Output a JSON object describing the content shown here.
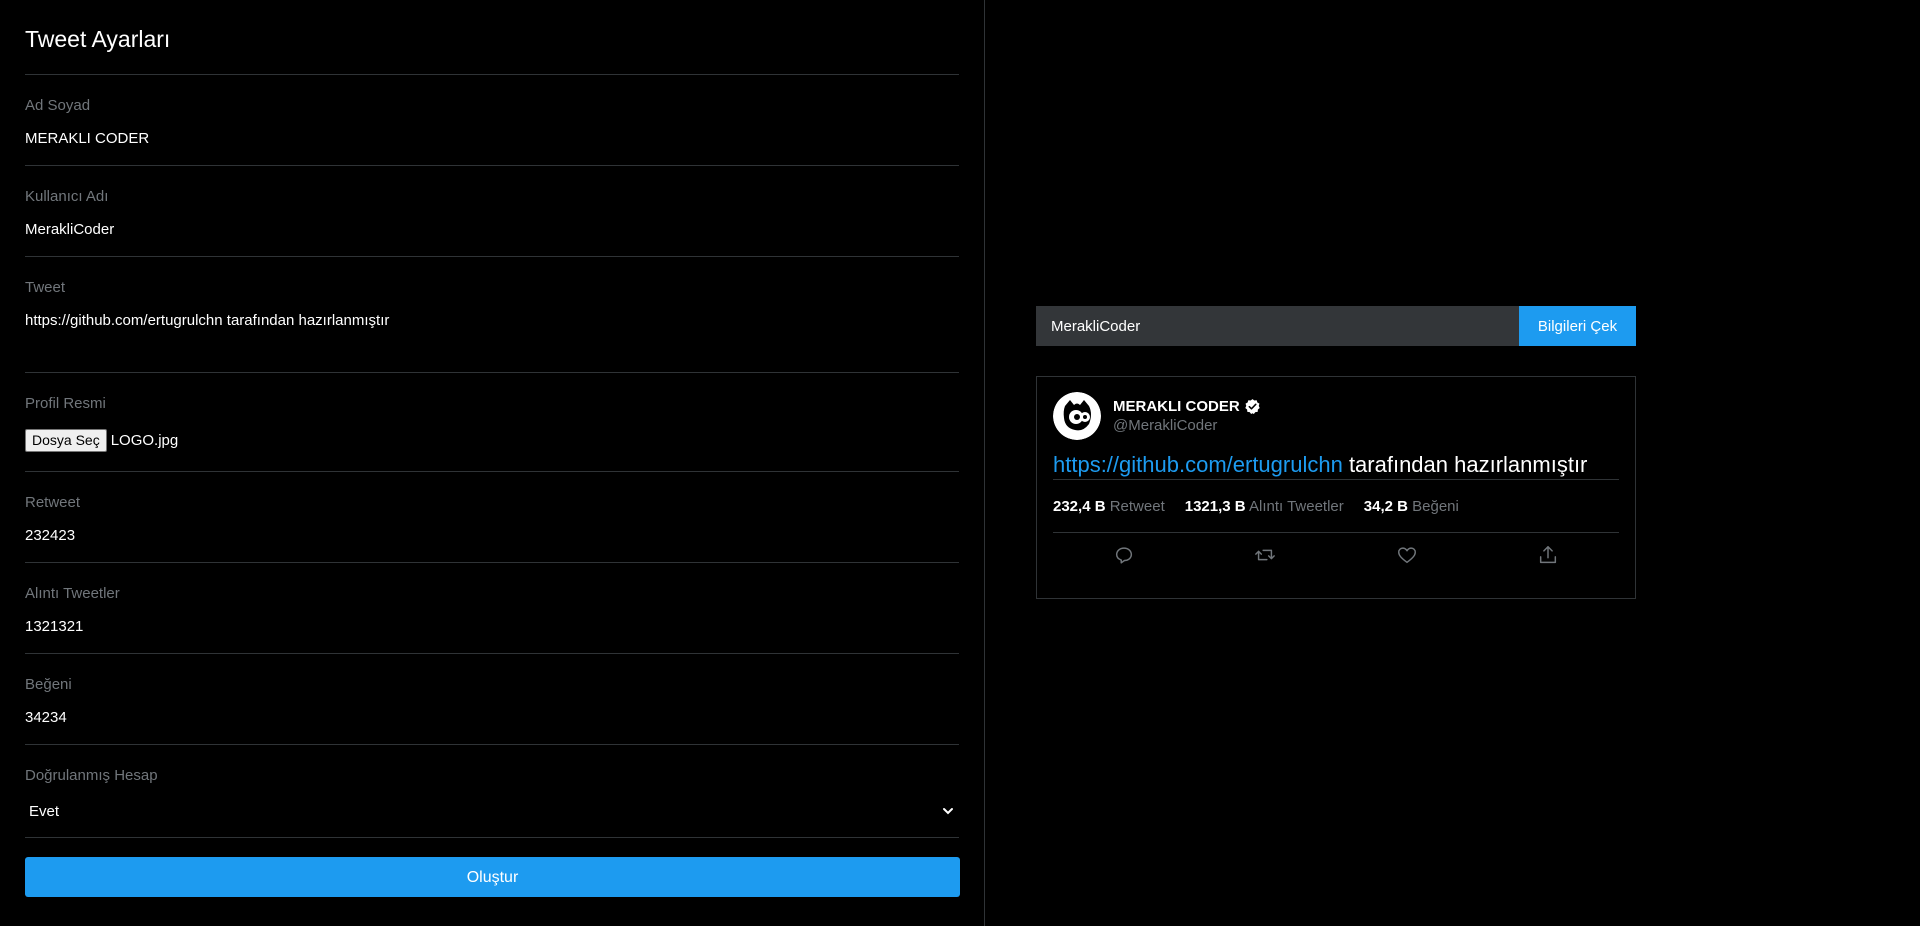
{
  "settings": {
    "title": "Tweet Ayarları",
    "fields": {
      "name": {
        "label": "Ad Soyad",
        "value": "MERAKLI CODER"
      },
      "username": {
        "label": "Kullanıcı Adı",
        "value": "MerakliCoder"
      },
      "tweet": {
        "label": "Tweet",
        "value": "https://github.com/ertugrulchn tarafından hazırlanmıştır"
      },
      "photo": {
        "label": "Profil Resmi",
        "button": "Dosya Seç",
        "file": "LOGO.jpg"
      },
      "retweet": {
        "label": "Retweet",
        "value": "232423"
      },
      "quote": {
        "label": "Alıntı Tweetler",
        "value": "1321321"
      },
      "like": {
        "label": "Beğeni",
        "value": "34234"
      },
      "verified": {
        "label": "Doğrulanmış Hesap",
        "value": "Evet"
      }
    },
    "submit_label": "Oluştur"
  },
  "preview": {
    "fetch": {
      "value": "MerakliCoder",
      "button": "Bilgileri Çek"
    },
    "tweet": {
      "display_name": "MERAKLI CODER",
      "handle": "@MerakliCoder",
      "link_text": "https://github.com/ertugrulchn",
      "text_rest": " tarafından hazırlanmıştır",
      "stats": {
        "retweet_num": "232,4 B",
        "retweet_label": "Retweet",
        "quote_num": "1321,3 B",
        "quote_label": "Alıntı Tweetler",
        "like_num": "34,2 B",
        "like_label": "Beğeni"
      },
      "actions": [
        "reply-icon",
        "retweet-icon",
        "like-icon",
        "share-icon"
      ]
    }
  },
  "colors": {
    "background": "#000000",
    "accent": "#1d9bf0",
    "muted": "#71767b",
    "border": "#2f3336"
  }
}
